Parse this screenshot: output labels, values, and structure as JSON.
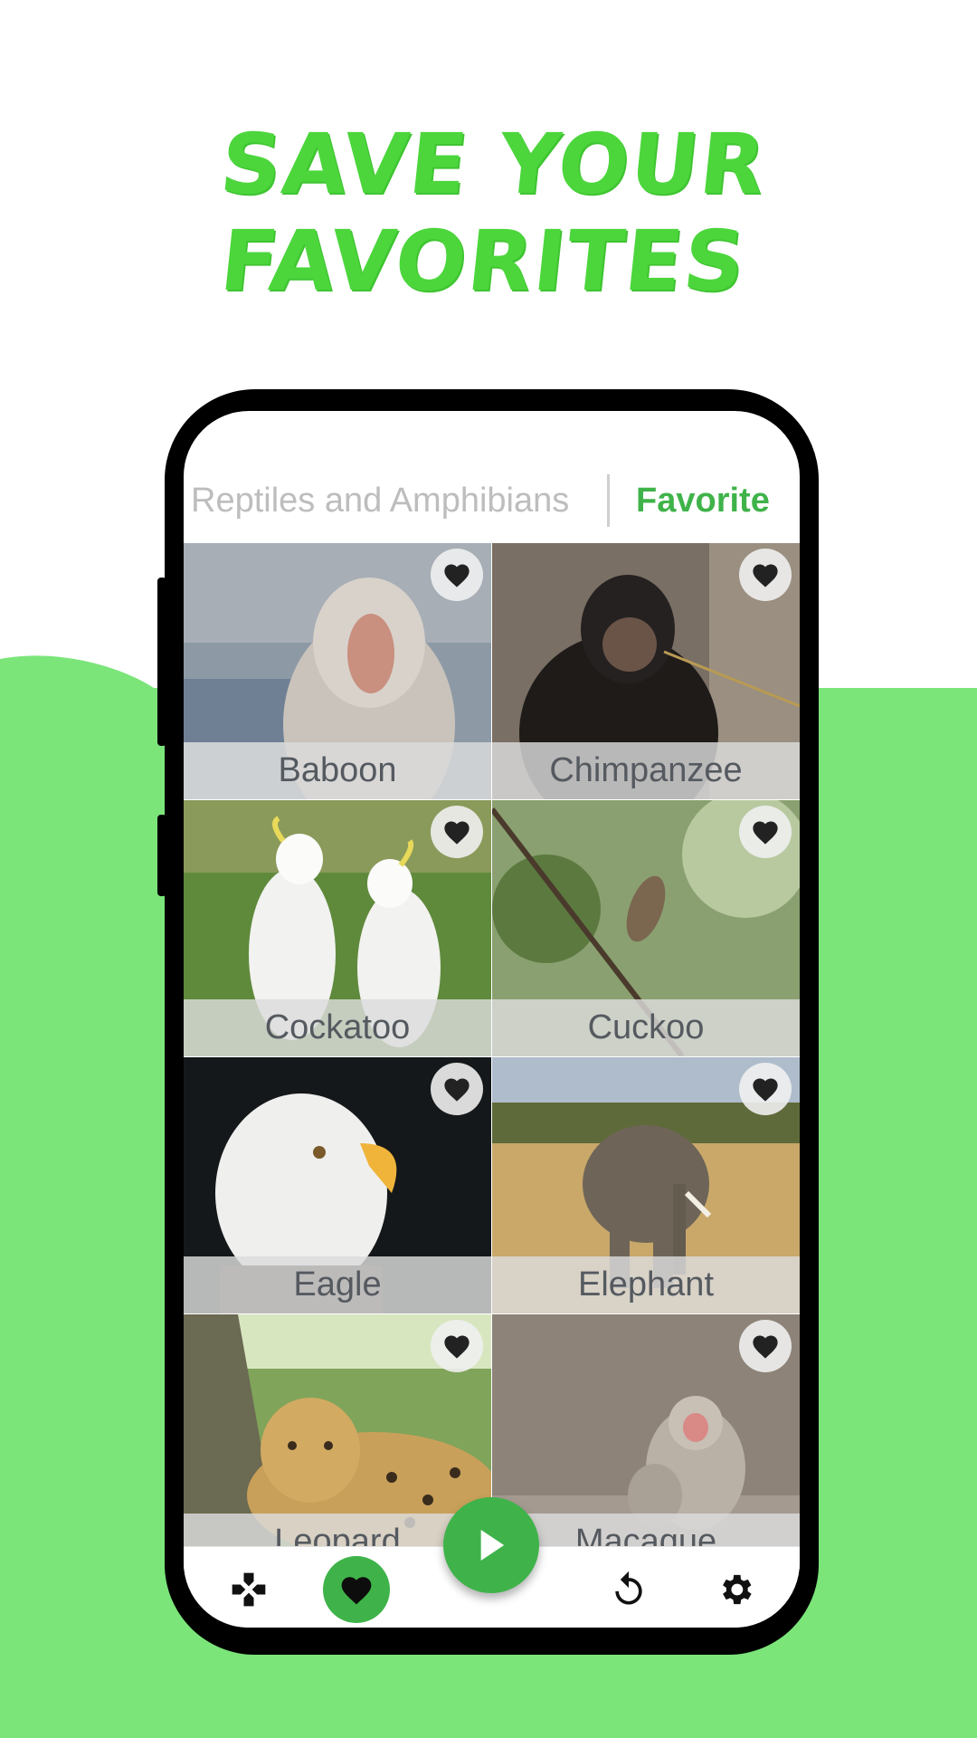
{
  "headline": "SAVE YOUR FAVORITES",
  "tabs": {
    "inactive_label": "Reptiles and Amphibians",
    "active_label": "Favorite"
  },
  "cards": [
    {
      "label": "Baboon"
    },
    {
      "label": "Chimpanzee"
    },
    {
      "label": "Cockatoo"
    },
    {
      "label": "Cuckoo"
    },
    {
      "label": "Eagle"
    },
    {
      "label": "Elephant"
    },
    {
      "label": "Leopard"
    },
    {
      "label": "Macaque"
    }
  ],
  "icons": {
    "favorite": "heart-icon",
    "games": "gamepad-icon",
    "favorites_nav": "heart-icon",
    "play": "play-icon",
    "reset": "refresh-icon",
    "settings": "gear-icon"
  },
  "colors": {
    "brand_green": "#3fb34a",
    "headline_green": "#4cd63c",
    "background_green": "#7be57a"
  }
}
